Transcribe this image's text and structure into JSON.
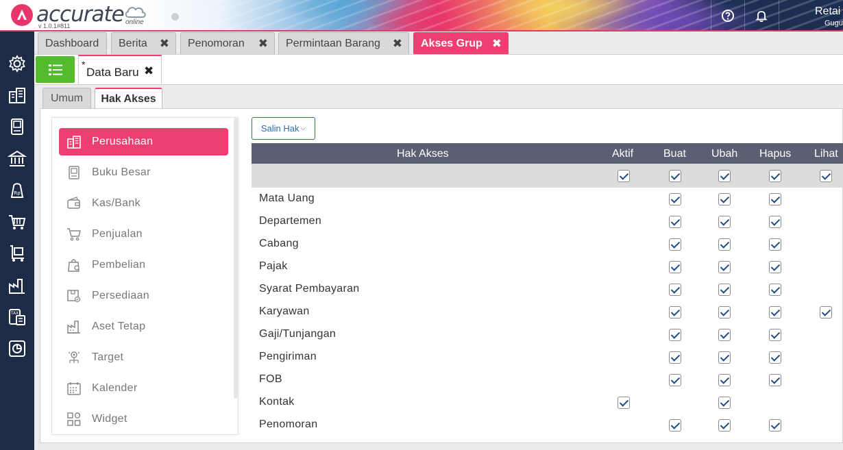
{
  "app": {
    "brand": "accurate",
    "brand_sub": "online",
    "version": "v 1.0.1#811",
    "user_line1": "Retai",
    "user_line2": "Gugu"
  },
  "main_tabs": [
    {
      "label": "Dashboard",
      "closable": false
    },
    {
      "label": "Berita",
      "closable": true
    },
    {
      "label": "Penomoran",
      "closable": true
    },
    {
      "label": "Permintaan Barang",
      "closable": true
    },
    {
      "label": "Akses Grup",
      "closable": true,
      "active": true
    }
  ],
  "doc_tab": {
    "star": "*",
    "label": "Data Baru",
    "close": "✖"
  },
  "sub_tabs": [
    {
      "label": "Umum"
    },
    {
      "label": "Hak Akses",
      "active": true
    }
  ],
  "menu": [
    {
      "label": "Perusahaan",
      "icon": "building-icon",
      "active": true
    },
    {
      "label": "Buku Besar",
      "icon": "ledger-book-icon"
    },
    {
      "label": "Kas/Bank",
      "icon": "wallet-icon"
    },
    {
      "label": "Penjualan",
      "icon": "shopping-cart-icon"
    },
    {
      "label": "Pembelian",
      "icon": "shopping-bag-icon"
    },
    {
      "label": "Persediaan",
      "icon": "inventory-box-icon"
    },
    {
      "label": "Aset Tetap",
      "icon": "factory-icon"
    },
    {
      "label": "Target",
      "icon": "target-icon"
    },
    {
      "label": "Kalender",
      "icon": "calendar-icon"
    },
    {
      "label": "Widget",
      "icon": "widget-icon"
    }
  ],
  "salin": {
    "label": "Salin Hak",
    "chevron": "⌵"
  },
  "grid": {
    "headers": {
      "name": "Hak Akses",
      "aktif": "Aktif",
      "buat": "Buat",
      "ubah": "Ubah",
      "hapus": "Hapus",
      "lihat": "Lihat"
    },
    "filter": {
      "aktif": true,
      "buat": true,
      "ubah": true,
      "hapus": true,
      "lihat": true
    },
    "rows": [
      {
        "name": "Mata Uang",
        "aktif": null,
        "buat": true,
        "ubah": true,
        "hapus": true,
        "lihat": null
      },
      {
        "name": "Departemen",
        "aktif": null,
        "buat": true,
        "ubah": true,
        "hapus": true,
        "lihat": null
      },
      {
        "name": "Cabang",
        "aktif": null,
        "buat": true,
        "ubah": true,
        "hapus": true,
        "lihat": null
      },
      {
        "name": "Pajak",
        "aktif": null,
        "buat": true,
        "ubah": true,
        "hapus": true,
        "lihat": null
      },
      {
        "name": "Syarat Pembayaran",
        "aktif": null,
        "buat": true,
        "ubah": true,
        "hapus": true,
        "lihat": null
      },
      {
        "name": "Karyawan",
        "aktif": null,
        "buat": true,
        "ubah": true,
        "hapus": true,
        "lihat": true
      },
      {
        "name": "Gaji/Tunjangan",
        "aktif": null,
        "buat": true,
        "ubah": true,
        "hapus": true,
        "lihat": null
      },
      {
        "name": "Pengiriman",
        "aktif": null,
        "buat": true,
        "ubah": true,
        "hapus": true,
        "lihat": null
      },
      {
        "name": "FOB",
        "aktif": null,
        "buat": true,
        "ubah": true,
        "hapus": true,
        "lihat": null
      },
      {
        "name": "Kontak",
        "aktif": true,
        "buat": null,
        "ubah": true,
        "hapus": null,
        "lihat": null
      },
      {
        "name": "Penomoran",
        "aktif": null,
        "buat": true,
        "ubah": true,
        "hapus": true,
        "lihat": null
      }
    ]
  },
  "colors": {
    "accent": "#ef3f70",
    "sidebar": "#1d2b46",
    "grid_header": "#5b5f74",
    "list_button": "#52bb2e"
  }
}
